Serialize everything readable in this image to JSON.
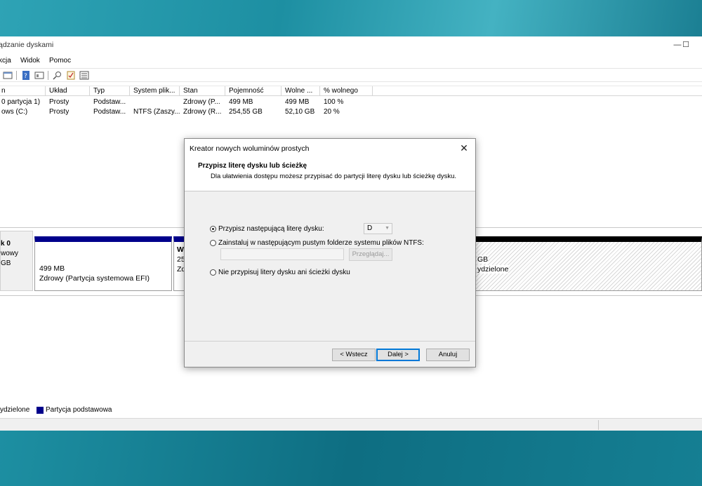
{
  "window": {
    "title": "ądzanie dyskami",
    "minimize": "—",
    "maximize": "☐"
  },
  "menu": [
    "kcja",
    "Widok",
    "Pomoc"
  ],
  "volume_list": {
    "headers": [
      "n",
      "Układ",
      "Typ",
      "System plik...",
      "Stan",
      "Pojemność",
      "Wolne ...",
      "% wolnego"
    ],
    "rows": [
      [
        "0 partycja 1)",
        "Prosty",
        "Podstaw...",
        "",
        "Zdrowy (P...",
        "499 MB",
        "499 MB",
        "100 %"
      ],
      [
        "ows (C:)",
        "Prosty",
        "Podstaw...",
        "NTFS (Zaszy...",
        "Zdrowy (R...",
        "254,55 GB",
        "52,10 GB",
        "20 %"
      ]
    ]
  },
  "disk": {
    "name": "k 0",
    "type": "wowy",
    "size": "GB",
    "partitions": [
      {
        "size": "499 MB",
        "status": "Zdrowy (Partycja systemowa EFI)"
      },
      {
        "size": "25",
        "name": "W",
        "status": "Zd"
      },
      {
        "size": "GB",
        "status": "ydzielone"
      }
    ]
  },
  "legend": {
    "unallocated": "ydzielone",
    "primary": "Partycja podstawowa"
  },
  "dialog": {
    "title": "Kreator nowych woluminów prostych",
    "close": "✕",
    "header_title": "Przypisz literę dysku lub ścieżkę",
    "header_subtitle": "Dla ułatwienia dostępu możesz przypisać do partycji literę dysku lub ścieżkę dysku.",
    "option_assign_letter": "Przypisz następującą literę dysku:",
    "drive_letter": "D",
    "option_mount_folder": "Zainstaluj w następującym pustym folderze systemu plików NTFS:",
    "browse_label": "Przeglądaj...",
    "option_no_letter": "Nie przypisuj litery dysku ani ścieżki dysku",
    "back_label": "< Wstecz",
    "next_label": "Dalej >",
    "cancel_label": "Anuluj"
  }
}
